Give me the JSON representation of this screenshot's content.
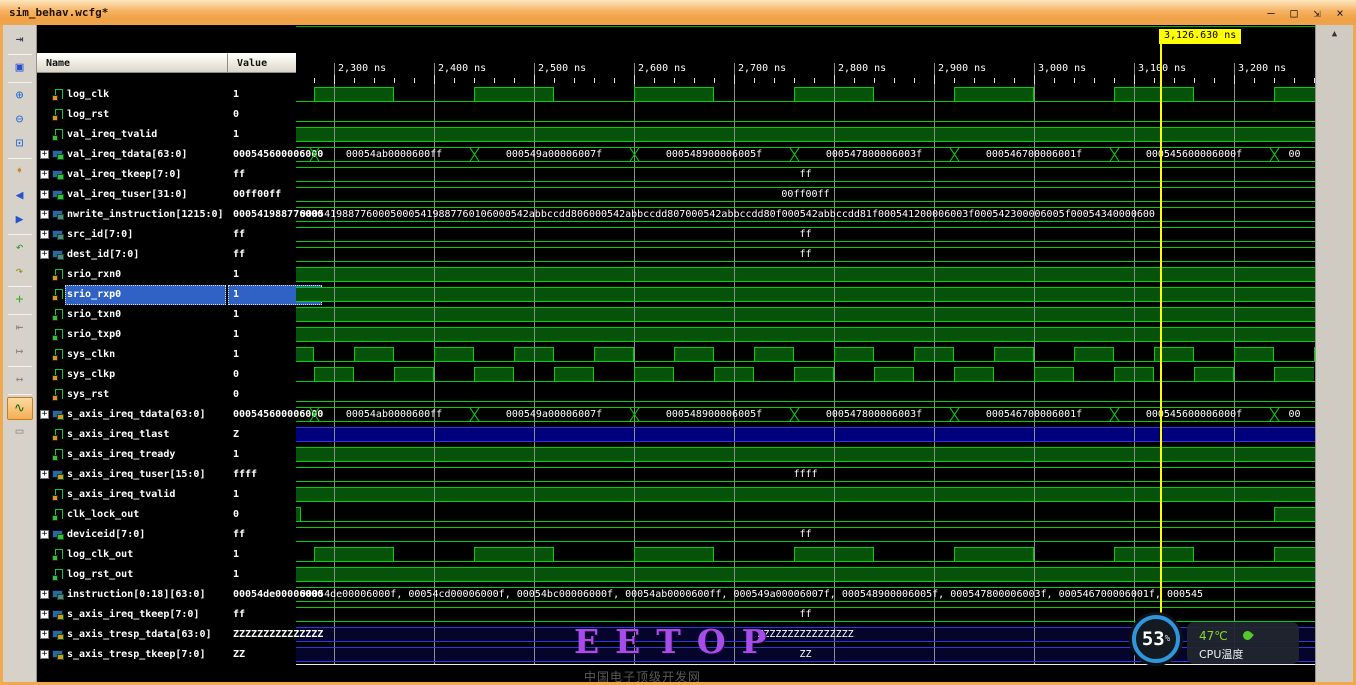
{
  "window": {
    "title": "sim_behav.wcfg*",
    "controls": [
      {
        "name": "minimize-button",
        "glyph": "—"
      },
      {
        "name": "maximize-button",
        "glyph": "□"
      },
      {
        "name": "restore-button",
        "glyph": "⇲"
      },
      {
        "name": "close-button",
        "glyph": "×"
      }
    ]
  },
  "toolbar": [
    {
      "name": "dock-icon",
      "glyph": "⇥",
      "color": "#3a3a6a"
    },
    {
      "sep": true
    },
    {
      "name": "save-icon",
      "glyph": "▣",
      "color": "#2b4fd0"
    },
    {
      "sep": true
    },
    {
      "name": "zoom-in-icon",
      "glyph": "⊕",
      "color": "#2b6fd0"
    },
    {
      "name": "zoom-out-icon",
      "glyph": "⊖",
      "color": "#2b6fd0"
    },
    {
      "name": "zoom-fit-icon",
      "glyph": "⊡",
      "color": "#2b6fd0"
    },
    {
      "sep": true
    },
    {
      "name": "go-to-edge-icon",
      "glyph": "➧",
      "color": "#d08020"
    },
    {
      "name": "previous-transition-icon",
      "glyph": "◀",
      "color": "#2255cc"
    },
    {
      "name": "next-transition-icon",
      "glyph": "▶",
      "color": "#2255cc"
    },
    {
      "sep": true
    },
    {
      "name": "undo-arrow-icon",
      "glyph": "↶",
      "color": "#3a9a3a"
    },
    {
      "name": "redo-arrow-icon",
      "glyph": "↷",
      "color": "#8a9a20"
    },
    {
      "sep": true
    },
    {
      "name": "add-marker-icon",
      "glyph": "+",
      "color": "#2fae2f"
    },
    {
      "sep": true
    },
    {
      "name": "previous-edge-icon",
      "glyph": "⇤",
      "color": "#8a8a8a"
    },
    {
      "name": "next-edge-icon",
      "glyph": "↦",
      "color": "#8a8a8a"
    },
    {
      "sep": true
    },
    {
      "name": "measure-icon",
      "glyph": "↔",
      "color": "#8a8a8a"
    },
    {
      "sep": true
    },
    {
      "name": "snap-to-transition-icon",
      "glyph": "∿",
      "color": "#0a6a0a",
      "active": true
    },
    {
      "name": "ruler-icon",
      "glyph": "▭",
      "color": "#8a8a8a"
    }
  ],
  "panel": {
    "name_header": "Name",
    "value_header": "Value",
    "signals": [
      {
        "name": "log_clk",
        "value": "1",
        "kind": "scalar",
        "tag": "orange"
      },
      {
        "name": "log_rst",
        "value": "0",
        "kind": "scalar",
        "tag": "orange"
      },
      {
        "name": "val_ireq_tvalid",
        "value": "1",
        "kind": "scalar",
        "tag": "green"
      },
      {
        "name": "val_ireq_tdata[63:0]",
        "value": "000545600006000",
        "kind": "bus",
        "tag": "green"
      },
      {
        "name": "val_ireq_tkeep[7:0]",
        "value": "ff",
        "kind": "bus",
        "tag": "green"
      },
      {
        "name": "val_ireq_tuser[31:0]",
        "value": "00ff00ff",
        "kind": "bus",
        "tag": "green"
      },
      {
        "name": "nwrite_instruction[1215:0]",
        "value": "000541988776000",
        "kind": "bus",
        "tag": "dark"
      },
      {
        "name": "src_id[7:0]",
        "value": "ff",
        "kind": "bus",
        "tag": "dark"
      },
      {
        "name": "dest_id[7:0]",
        "value": "ff",
        "kind": "bus",
        "tag": "dark"
      },
      {
        "name": "srio_rxn0",
        "value": "1",
        "kind": "scalar",
        "tag": "orange"
      },
      {
        "name": "srio_rxp0",
        "value": "1",
        "kind": "scalar",
        "tag": "orange",
        "selected": true
      },
      {
        "name": "srio_txn0",
        "value": "1",
        "kind": "scalar",
        "tag": "green"
      },
      {
        "name": "srio_txp0",
        "value": "1",
        "kind": "scalar",
        "tag": "green"
      },
      {
        "name": "sys_clkn",
        "value": "1",
        "kind": "scalar",
        "tag": "orange"
      },
      {
        "name": "sys_clkp",
        "value": "0",
        "kind": "scalar",
        "tag": "orange"
      },
      {
        "name": "sys_rst",
        "value": "0",
        "kind": "scalar",
        "tag": "orange"
      },
      {
        "name": "s_axis_ireq_tdata[63:0]",
        "value": "000545600006000",
        "kind": "bus",
        "tag": "orange"
      },
      {
        "name": "s_axis_ireq_tlast",
        "value": "Z",
        "kind": "scalar",
        "tag": "orange"
      },
      {
        "name": "s_axis_ireq_tready",
        "value": "1",
        "kind": "scalar",
        "tag": "green"
      },
      {
        "name": "s_axis_ireq_tuser[15:0]",
        "value": "ffff",
        "kind": "bus",
        "tag": "orange"
      },
      {
        "name": "s_axis_ireq_tvalid",
        "value": "1",
        "kind": "scalar",
        "tag": "orange"
      },
      {
        "name": "clk_lock_out",
        "value": "0",
        "kind": "scalar",
        "tag": "green"
      },
      {
        "name": "deviceid[7:0]",
        "value": "ff",
        "kind": "bus",
        "tag": "green"
      },
      {
        "name": "log_clk_out",
        "value": "1",
        "kind": "scalar",
        "tag": "green"
      },
      {
        "name": "log_rst_out",
        "value": "1",
        "kind": "scalar",
        "tag": "green"
      },
      {
        "name": "instruction[0:18][63:0]",
        "value": "00054de00006000",
        "kind": "bus",
        "tag": "dark"
      },
      {
        "name": "s_axis_ireq_tkeep[7:0]",
        "value": "ff",
        "kind": "bus",
        "tag": "orange"
      },
      {
        "name": "s_axis_tresp_tdata[63:0]",
        "value": "ZZZZZZZZZZZZZZZ",
        "kind": "bus",
        "tag": "orange"
      },
      {
        "name": "s_axis_tresp_tkeep[7:0]",
        "value": "ZZ",
        "kind": "bus",
        "tag": "orange"
      }
    ]
  },
  "wave": {
    "axis": {
      "unit": "ns",
      "t0": 2262,
      "t1": 3281,
      "minor_step": 20,
      "major_step": 100,
      "labels": [
        {
          "t": 2300,
          "text": "2,300 ns"
        },
        {
          "t": 2400,
          "text": "2,400 ns"
        },
        {
          "t": 2500,
          "text": "2,500 ns"
        },
        {
          "t": 2600,
          "text": "2,600 ns"
        },
        {
          "t": 2700,
          "text": "2,700 ns"
        },
        {
          "t": 2800,
          "text": "2,800 ns"
        },
        {
          "t": 2900,
          "text": "2,900 ns"
        },
        {
          "t": 3000,
          "text": "3,000 ns"
        },
        {
          "t": 3100,
          "text": "3,100 ns"
        },
        {
          "t": 3200,
          "text": "3,200 ns"
        }
      ]
    },
    "cursor": {
      "t": 3127,
      "label": "3,126.630 ns"
    },
    "rows": [
      {
        "type": "bit",
        "high": [
          [
            2280,
            2360
          ],
          [
            2440,
            2520
          ],
          [
            2600,
            2680
          ],
          [
            2760,
            2840
          ],
          [
            2920,
            3000
          ],
          [
            3080,
            3160
          ],
          [
            3240,
            3281
          ]
        ]
      },
      {
        "type": "bit",
        "high": []
      },
      {
        "type": "bit",
        "high": [
          [
            2262,
            3281
          ]
        ]
      },
      {
        "type": "bus",
        "segments": [
          {
            "t0": 2262,
            "t1": 2280,
            "label": ""
          },
          {
            "t0": 2280,
            "t1": 2440,
            "label": "00054ab0000600ff"
          },
          {
            "t0": 2440,
            "t1": 2600,
            "label": "000549a00006007f"
          },
          {
            "t0": 2600,
            "t1": 2760,
            "label": "000548900006005f"
          },
          {
            "t0": 2760,
            "t1": 2920,
            "label": "000547800006003f"
          },
          {
            "t0": 2920,
            "t1": 3080,
            "label": "000546700006001f"
          },
          {
            "t0": 3080,
            "t1": 3240,
            "label": "000545600006000f"
          },
          {
            "t0": 3240,
            "t1": 3281,
            "label": "00"
          }
        ]
      },
      {
        "type": "bus",
        "segments": [
          {
            "t0": 2262,
            "t1": 3281,
            "label": "ff"
          }
        ]
      },
      {
        "type": "bus",
        "segments": [
          {
            "t0": 2262,
            "t1": 3281,
            "label": "00ff00ff"
          }
        ]
      },
      {
        "type": "bus",
        "align": "left",
        "segments": [
          {
            "t0": 2262,
            "t1": 3281,
            "label": "00054198877600050005419887760106000542abbccdd806000542abbccdd807000542abbccdd80f000542abbccdd81f000541200006003f000542300006005f00054340000600"
          }
        ]
      },
      {
        "type": "bus",
        "segments": [
          {
            "t0": 2262,
            "t1": 3281,
            "label": "ff"
          }
        ]
      },
      {
        "type": "bus",
        "segments": [
          {
            "t0": 2262,
            "t1": 3281,
            "label": "ff"
          }
        ]
      },
      {
        "type": "bit",
        "high": [
          [
            2262,
            3281
          ]
        ]
      },
      {
        "type": "bit",
        "high": [
          [
            2262,
            3281
          ]
        ]
      },
      {
        "type": "bit",
        "high": [
          [
            2262,
            3281
          ]
        ]
      },
      {
        "type": "bit",
        "high": [
          [
            2262,
            3281
          ]
        ]
      },
      {
        "type": "bit",
        "high": [
          [
            2262,
            2280
          ],
          [
            2320,
            2360
          ],
          [
            2400,
            2440
          ],
          [
            2480,
            2520
          ],
          [
            2560,
            2600
          ],
          [
            2640,
            2680
          ],
          [
            2720,
            2760
          ],
          [
            2800,
            2840
          ],
          [
            2880,
            2920
          ],
          [
            2960,
            3000
          ],
          [
            3040,
            3080
          ],
          [
            3120,
            3160
          ],
          [
            3200,
            3240
          ],
          [
            3280,
            3281
          ]
        ]
      },
      {
        "type": "bit",
        "high": [
          [
            2280,
            2320
          ],
          [
            2360,
            2400
          ],
          [
            2440,
            2480
          ],
          [
            2520,
            2560
          ],
          [
            2600,
            2640
          ],
          [
            2680,
            2720
          ],
          [
            2760,
            2800
          ],
          [
            2840,
            2880
          ],
          [
            2920,
            2960
          ],
          [
            3000,
            3040
          ],
          [
            3080,
            3120
          ],
          [
            3160,
            3200
          ],
          [
            3240,
            3280
          ]
        ]
      },
      {
        "type": "bit",
        "high": []
      },
      {
        "type": "bus",
        "segments": [
          {
            "t0": 2262,
            "t1": 2280,
            "label": ""
          },
          {
            "t0": 2280,
            "t1": 2440,
            "label": "00054ab0000600ff"
          },
          {
            "t0": 2440,
            "t1": 2600,
            "label": "000549a00006007f"
          },
          {
            "t0": 2600,
            "t1": 2760,
            "label": "000548900006005f"
          },
          {
            "t0": 2760,
            "t1": 2920,
            "label": "000547800006003f"
          },
          {
            "t0": 2920,
            "t1": 3080,
            "label": "000546700006001f"
          },
          {
            "t0": 3080,
            "t1": 3240,
            "label": "000545600006000f"
          },
          {
            "t0": 3240,
            "t1": 3281,
            "label": "00"
          }
        ]
      },
      {
        "type": "zband"
      },
      {
        "type": "bit",
        "high": [
          [
            2262,
            3281
          ]
        ]
      },
      {
        "type": "bus",
        "segments": [
          {
            "t0": 2262,
            "t1": 3281,
            "label": "ffff"
          }
        ]
      },
      {
        "type": "bit",
        "high": [
          [
            2262,
            3281
          ]
        ]
      },
      {
        "type": "bit",
        "high": [
          [
            2262,
            2267
          ],
          [
            3240,
            3281
          ]
        ]
      },
      {
        "type": "bus",
        "segments": [
          {
            "t0": 2262,
            "t1": 3281,
            "label": "ff"
          }
        ]
      },
      {
        "type": "bit",
        "high": [
          [
            2280,
            2360
          ],
          [
            2440,
            2520
          ],
          [
            2600,
            2680
          ],
          [
            2760,
            2840
          ],
          [
            2920,
            3000
          ],
          [
            3080,
            3160
          ],
          [
            3240,
            3281
          ]
        ]
      },
      {
        "type": "bit",
        "high": [
          [
            2262,
            3281
          ]
        ]
      },
      {
        "type": "bus",
        "align": "left",
        "segments": [
          {
            "t0": 2262,
            "t1": 3281,
            "label": "00054de00006000f, 00054cd00006000f, 00054bc00006000f, 00054ab0000600ff, 000549a00006007f, 000548900006005f, 000547800006003f, 000546700006001f, 000545"
          }
        ]
      },
      {
        "type": "bus",
        "segments": [
          {
            "t0": 2262,
            "t1": 3281,
            "label": "ff"
          }
        ]
      },
      {
        "type": "bus",
        "blue": true,
        "segments": [
          {
            "t0": 2262,
            "t1": 3281,
            "label": "ZZZZZZZZZZZZZZZZ"
          }
        ]
      },
      {
        "type": "bus",
        "blue": true,
        "segments": [
          {
            "t0": 2262,
            "t1": 3281,
            "label": "ZZ"
          }
        ]
      }
    ]
  },
  "watermark": {
    "brand": "EETOP",
    "caption": "中国电子顶级开发网"
  },
  "cpu_widget": {
    "percent": "53",
    "percent_suffix": "%",
    "temp": "47℃",
    "label": "CPU温度"
  },
  "scrollbar": {
    "up_glyph": "▲"
  },
  "colors": {
    "wave_green": "#00d200",
    "wave_fill": "#07520a",
    "wave_blue": "#3232e8",
    "z_fill": "#00007d",
    "blue_fill": "rgba(10,10,80,0.55)",
    "cursor": "#ffff00",
    "selection": "#2f62c4",
    "tag_orange": "#e09420",
    "tag_green": "#35c035",
    "tag_dark": "#6a7a8a"
  }
}
